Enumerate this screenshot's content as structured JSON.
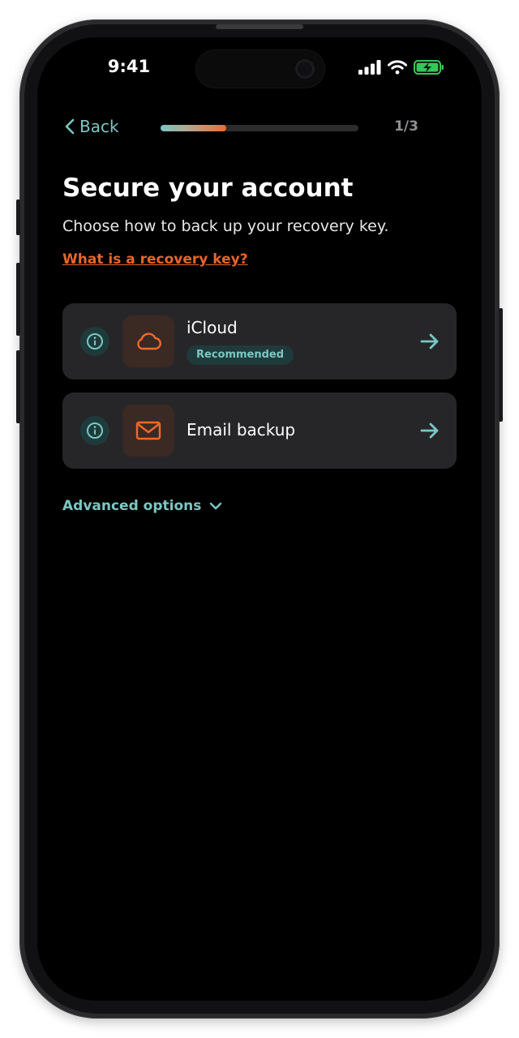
{
  "status_bar": {
    "time": "9:41"
  },
  "nav": {
    "back_label": "Back",
    "step_count": "1/3",
    "progress": 0.33
  },
  "header": {
    "title": "Secure your account",
    "subtitle": "Choose how to back up your recovery key.",
    "help_link": "What is a recovery key?"
  },
  "options": [
    {
      "label": "iCloud",
      "badge": "Recommended",
      "icon": "cloud-icon"
    },
    {
      "label": "Email backup",
      "icon": "mail-icon"
    }
  ],
  "advanced": {
    "label": "Advanced options"
  },
  "colors": {
    "accent_teal": "#7ac7c3",
    "accent_orange": "#f06a2a",
    "card_bg": "#262628",
    "screen_bg": "#000000",
    "battery_green": "#34c759"
  }
}
